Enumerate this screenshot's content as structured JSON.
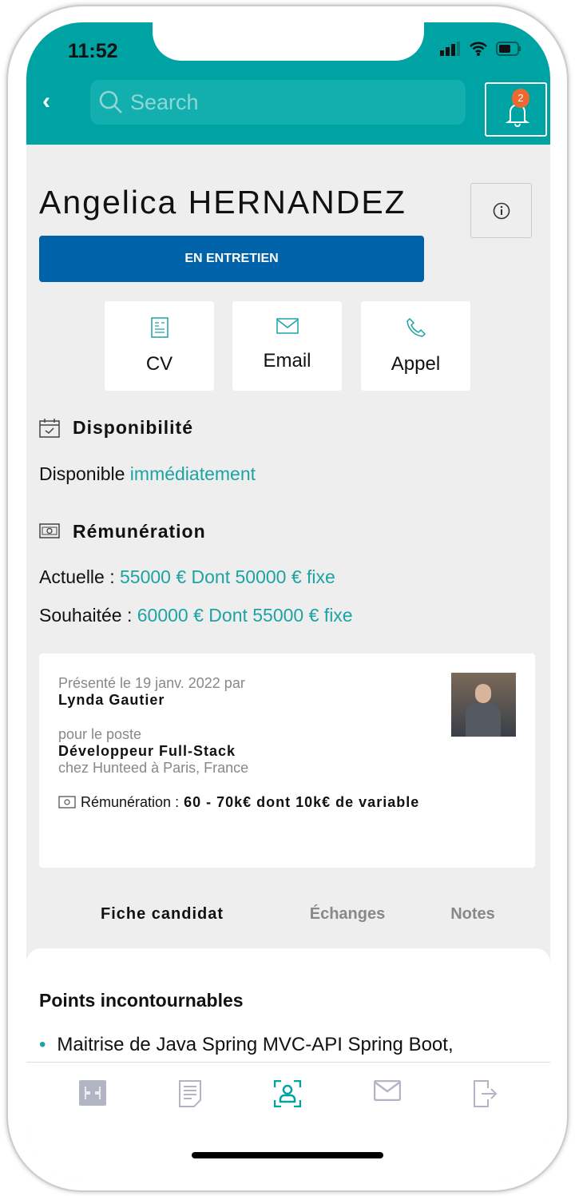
{
  "status_bar": {
    "time": "11:52"
  },
  "header": {
    "search_placeholder": "Search",
    "notification_count": "2"
  },
  "candidate": {
    "name": "Angelica HERNANDEZ",
    "status": "EN ENTRETIEN"
  },
  "actions": [
    {
      "label": "CV",
      "icon": "document-icon"
    },
    {
      "label": "Email",
      "icon": "envelope-icon"
    },
    {
      "label": "Appel",
      "icon": "phone-icon"
    }
  ],
  "availability": {
    "title": "Disponibilité",
    "prefix": "Disponible",
    "value": "immédiatement"
  },
  "salary": {
    "title": "Rémunération",
    "current_label": "Actuelle :",
    "current_value": "55000 € Dont 50000 € fixe",
    "desired_label": "Souhaitée :",
    "desired_value": "60000 € Dont 55000 € fixe"
  },
  "presentation": {
    "presented": "Présenté le 19 janv. 2022 par",
    "recruiter": "Lynda Gautier",
    "for_label": "pour le poste",
    "position": "Développeur Full-Stack",
    "company": "chez Hunteed à Paris, France",
    "salary_label": "Rémunération :",
    "salary_value": "60 - 70k€ dont 10k€ de variable"
  },
  "tabs": [
    {
      "label": "Fiche candidat",
      "active": true
    },
    {
      "label": "Échanges"
    },
    {
      "label": "Notes"
    }
  ],
  "panel": {
    "title": "Points incontournables",
    "bullets": [
      "Maitrise de Java Spring MVC-API Spring Boot,"
    ]
  },
  "colors": {
    "teal": "#00a3a3",
    "blue": "#0062a8",
    "badge": "#ec6a31"
  }
}
